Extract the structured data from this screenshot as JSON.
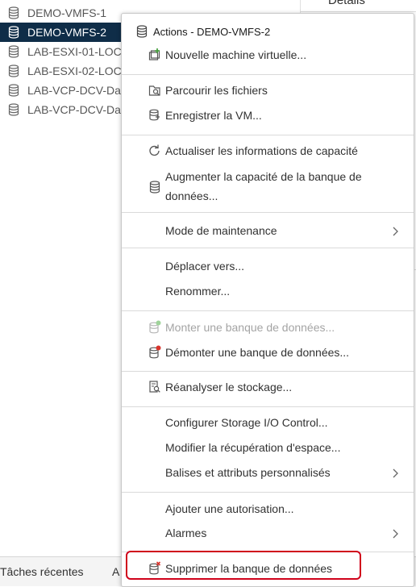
{
  "tree": {
    "items": [
      {
        "label": "DEMO-VMFS-1",
        "selected": false
      },
      {
        "label": "DEMO-VMFS-2",
        "selected": true
      },
      {
        "label": "LAB-ESXI-01-LOC",
        "selected": false
      },
      {
        "label": "LAB-ESXI-02-LOC",
        "selected": false
      },
      {
        "label": "LAB-VCP-DCV-Da",
        "selected": false
      },
      {
        "label": "LAB-VCP-DCV-Da",
        "selected": false
      }
    ]
  },
  "right_pane": {
    "tab_label": "Détails"
  },
  "bottom_bar": {
    "recent_tasks_label": "Tâches récentes",
    "second_tab_label": "A"
  },
  "menu": {
    "header": "Actions - DEMO-VMFS-2",
    "items": [
      {
        "label": "Nouvelle machine virtuelle...",
        "icon": "new-vm-icon"
      },
      {
        "label": "Parcourir les fichiers",
        "icon": "browse-files-icon"
      },
      {
        "label": "Enregistrer la VM...",
        "icon": "register-vm-icon"
      },
      {
        "label": "Actualiser les informations de capacité",
        "icon": "refresh-icon"
      },
      {
        "label": "Augmenter la capacité de la banque de données...",
        "icon": "datastore-icon"
      },
      {
        "label": "Mode de maintenance",
        "icon": "",
        "submenu": true
      },
      {
        "label": "Déplacer vers...",
        "icon": ""
      },
      {
        "label": "Renommer...",
        "icon": ""
      },
      {
        "label": "Monter une banque de données...",
        "icon": "mount-datastore-icon",
        "disabled": true
      },
      {
        "label": "Démonter une banque de données...",
        "icon": "unmount-datastore-icon"
      },
      {
        "label": "Réanalyser le stockage...",
        "icon": "rescan-storage-icon"
      },
      {
        "label": "Configurer Storage I/O Control...",
        "icon": ""
      },
      {
        "label": "Modifier la récupération d'espace...",
        "icon": ""
      },
      {
        "label": "Balises et attributs personnalisés",
        "icon": "",
        "submenu": true
      },
      {
        "label": "Ajouter une autorisation...",
        "icon": ""
      },
      {
        "label": "Alarmes",
        "icon": "",
        "submenu": true
      },
      {
        "label": "Supprimer la banque de données",
        "icon": "delete-datastore-icon",
        "highlighted": true
      }
    ]
  },
  "colors": {
    "selected_bg": "#0f2d48",
    "highlight_border": "#d0021b",
    "icon_accent_green": "#3c9a33",
    "icon_accent_red": "#d9332b",
    "disabled_text": "#a4a4a4"
  }
}
